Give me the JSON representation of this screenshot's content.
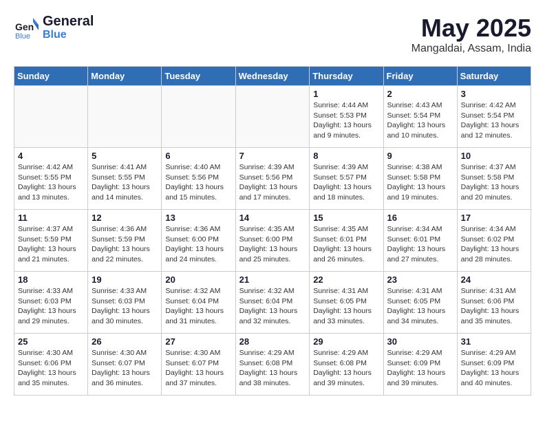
{
  "header": {
    "logo_line1": "General",
    "logo_line2": "Blue",
    "month": "May 2025",
    "location": "Mangaldai, Assam, India"
  },
  "weekdays": [
    "Sunday",
    "Monday",
    "Tuesday",
    "Wednesday",
    "Thursday",
    "Friday",
    "Saturday"
  ],
  "weeks": [
    [
      {
        "day": "",
        "empty": true
      },
      {
        "day": "",
        "empty": true
      },
      {
        "day": "",
        "empty": true
      },
      {
        "day": "",
        "empty": true
      },
      {
        "day": "1",
        "sunrise": "4:44 AM",
        "sunset": "5:53 PM",
        "daylight": "13 hours and 9 minutes."
      },
      {
        "day": "2",
        "sunrise": "4:43 AM",
        "sunset": "5:54 PM",
        "daylight": "13 hours and 10 minutes."
      },
      {
        "day": "3",
        "sunrise": "4:42 AM",
        "sunset": "5:54 PM",
        "daylight": "13 hours and 12 minutes."
      }
    ],
    [
      {
        "day": "4",
        "sunrise": "4:42 AM",
        "sunset": "5:55 PM",
        "daylight": "13 hours and 13 minutes."
      },
      {
        "day": "5",
        "sunrise": "4:41 AM",
        "sunset": "5:55 PM",
        "daylight": "13 hours and 14 minutes."
      },
      {
        "day": "6",
        "sunrise": "4:40 AM",
        "sunset": "5:56 PM",
        "daylight": "13 hours and 15 minutes."
      },
      {
        "day": "7",
        "sunrise": "4:39 AM",
        "sunset": "5:56 PM",
        "daylight": "13 hours and 17 minutes."
      },
      {
        "day": "8",
        "sunrise": "4:39 AM",
        "sunset": "5:57 PM",
        "daylight": "13 hours and 18 minutes."
      },
      {
        "day": "9",
        "sunrise": "4:38 AM",
        "sunset": "5:58 PM",
        "daylight": "13 hours and 19 minutes."
      },
      {
        "day": "10",
        "sunrise": "4:37 AM",
        "sunset": "5:58 PM",
        "daylight": "13 hours and 20 minutes."
      }
    ],
    [
      {
        "day": "11",
        "sunrise": "4:37 AM",
        "sunset": "5:59 PM",
        "daylight": "13 hours and 21 minutes."
      },
      {
        "day": "12",
        "sunrise": "4:36 AM",
        "sunset": "5:59 PM",
        "daylight": "13 hours and 22 minutes."
      },
      {
        "day": "13",
        "sunrise": "4:36 AM",
        "sunset": "6:00 PM",
        "daylight": "13 hours and 24 minutes."
      },
      {
        "day": "14",
        "sunrise": "4:35 AM",
        "sunset": "6:00 PM",
        "daylight": "13 hours and 25 minutes."
      },
      {
        "day": "15",
        "sunrise": "4:35 AM",
        "sunset": "6:01 PM",
        "daylight": "13 hours and 26 minutes."
      },
      {
        "day": "16",
        "sunrise": "4:34 AM",
        "sunset": "6:01 PM",
        "daylight": "13 hours and 27 minutes."
      },
      {
        "day": "17",
        "sunrise": "4:34 AM",
        "sunset": "6:02 PM",
        "daylight": "13 hours and 28 minutes."
      }
    ],
    [
      {
        "day": "18",
        "sunrise": "4:33 AM",
        "sunset": "6:03 PM",
        "daylight": "13 hours and 29 minutes."
      },
      {
        "day": "19",
        "sunrise": "4:33 AM",
        "sunset": "6:03 PM",
        "daylight": "13 hours and 30 minutes."
      },
      {
        "day": "20",
        "sunrise": "4:32 AM",
        "sunset": "6:04 PM",
        "daylight": "13 hours and 31 minutes."
      },
      {
        "day": "21",
        "sunrise": "4:32 AM",
        "sunset": "6:04 PM",
        "daylight": "13 hours and 32 minutes."
      },
      {
        "day": "22",
        "sunrise": "4:31 AM",
        "sunset": "6:05 PM",
        "daylight": "13 hours and 33 minutes."
      },
      {
        "day": "23",
        "sunrise": "4:31 AM",
        "sunset": "6:05 PM",
        "daylight": "13 hours and 34 minutes."
      },
      {
        "day": "24",
        "sunrise": "4:31 AM",
        "sunset": "6:06 PM",
        "daylight": "13 hours and 35 minutes."
      }
    ],
    [
      {
        "day": "25",
        "sunrise": "4:30 AM",
        "sunset": "6:06 PM",
        "daylight": "13 hours and 35 minutes."
      },
      {
        "day": "26",
        "sunrise": "4:30 AM",
        "sunset": "6:07 PM",
        "daylight": "13 hours and 36 minutes."
      },
      {
        "day": "27",
        "sunrise": "4:30 AM",
        "sunset": "6:07 PM",
        "daylight": "13 hours and 37 minutes."
      },
      {
        "day": "28",
        "sunrise": "4:29 AM",
        "sunset": "6:08 PM",
        "daylight": "13 hours and 38 minutes."
      },
      {
        "day": "29",
        "sunrise": "4:29 AM",
        "sunset": "6:08 PM",
        "daylight": "13 hours and 39 minutes."
      },
      {
        "day": "30",
        "sunrise": "4:29 AM",
        "sunset": "6:09 PM",
        "daylight": "13 hours and 39 minutes."
      },
      {
        "day": "31",
        "sunrise": "4:29 AM",
        "sunset": "6:09 PM",
        "daylight": "13 hours and 40 minutes."
      }
    ]
  ]
}
